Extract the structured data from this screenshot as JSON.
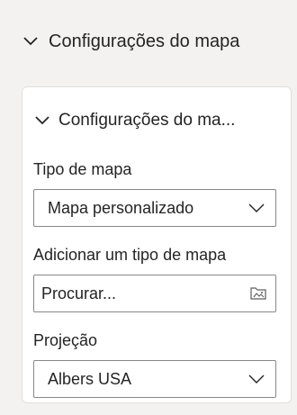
{
  "section": {
    "title": "Configurações do mapa",
    "icon": "chevron-down-icon"
  },
  "card": {
    "title": "Configurações do ma...",
    "icon": "chevron-down-icon",
    "map_type": {
      "label": "Tipo de mapa",
      "selected": "Mapa personalizado",
      "icon": "chevron-down-icon"
    },
    "add_map_type": {
      "label": "Adicionar um tipo de mapa",
      "placeholder": "Procurar...",
      "icon": "browse-file-icon"
    },
    "projection": {
      "label": "Projeção",
      "selected": "Albers USA",
      "icon": "chevron-down-icon"
    }
  },
  "colors": {
    "background": "#f3f2f1",
    "card": "#ffffff",
    "border": "#8a8886",
    "text": "#252423"
  }
}
